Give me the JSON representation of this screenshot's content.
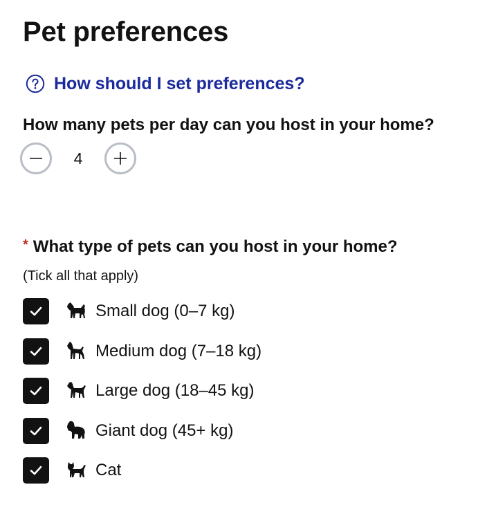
{
  "page": {
    "title": "Pet preferences"
  },
  "help": {
    "icon": "question-circle-icon",
    "label": "How should I set preferences?",
    "color": "#1b2a9c"
  },
  "capacity": {
    "question": "How many pets per day can you host in your home?",
    "value": "4",
    "decrement_icon": "minus-icon",
    "increment_icon": "plus-icon"
  },
  "pet_types": {
    "required_marker": "*",
    "question": "What type of pets can you host in your home?",
    "hint": "(Tick all that apply)",
    "options": [
      {
        "label": "Small dog (0–7 kg)",
        "icon": "small-dog-icon",
        "checked": true
      },
      {
        "label": "Medium dog (7–18 kg)",
        "icon": "medium-dog-icon",
        "checked": true
      },
      {
        "label": "Large dog (18–45 kg)",
        "icon": "large-dog-icon",
        "checked": true
      },
      {
        "label": "Giant dog (45+ kg)",
        "icon": "giant-dog-icon",
        "checked": true
      },
      {
        "label": "Cat",
        "icon": "cat-icon",
        "checked": true
      }
    ]
  },
  "colors": {
    "text": "#121212",
    "link": "#1b2a9c",
    "required": "#c2261a",
    "stepper_border": "#b9bec6",
    "checkbox_fill": "#121212"
  }
}
